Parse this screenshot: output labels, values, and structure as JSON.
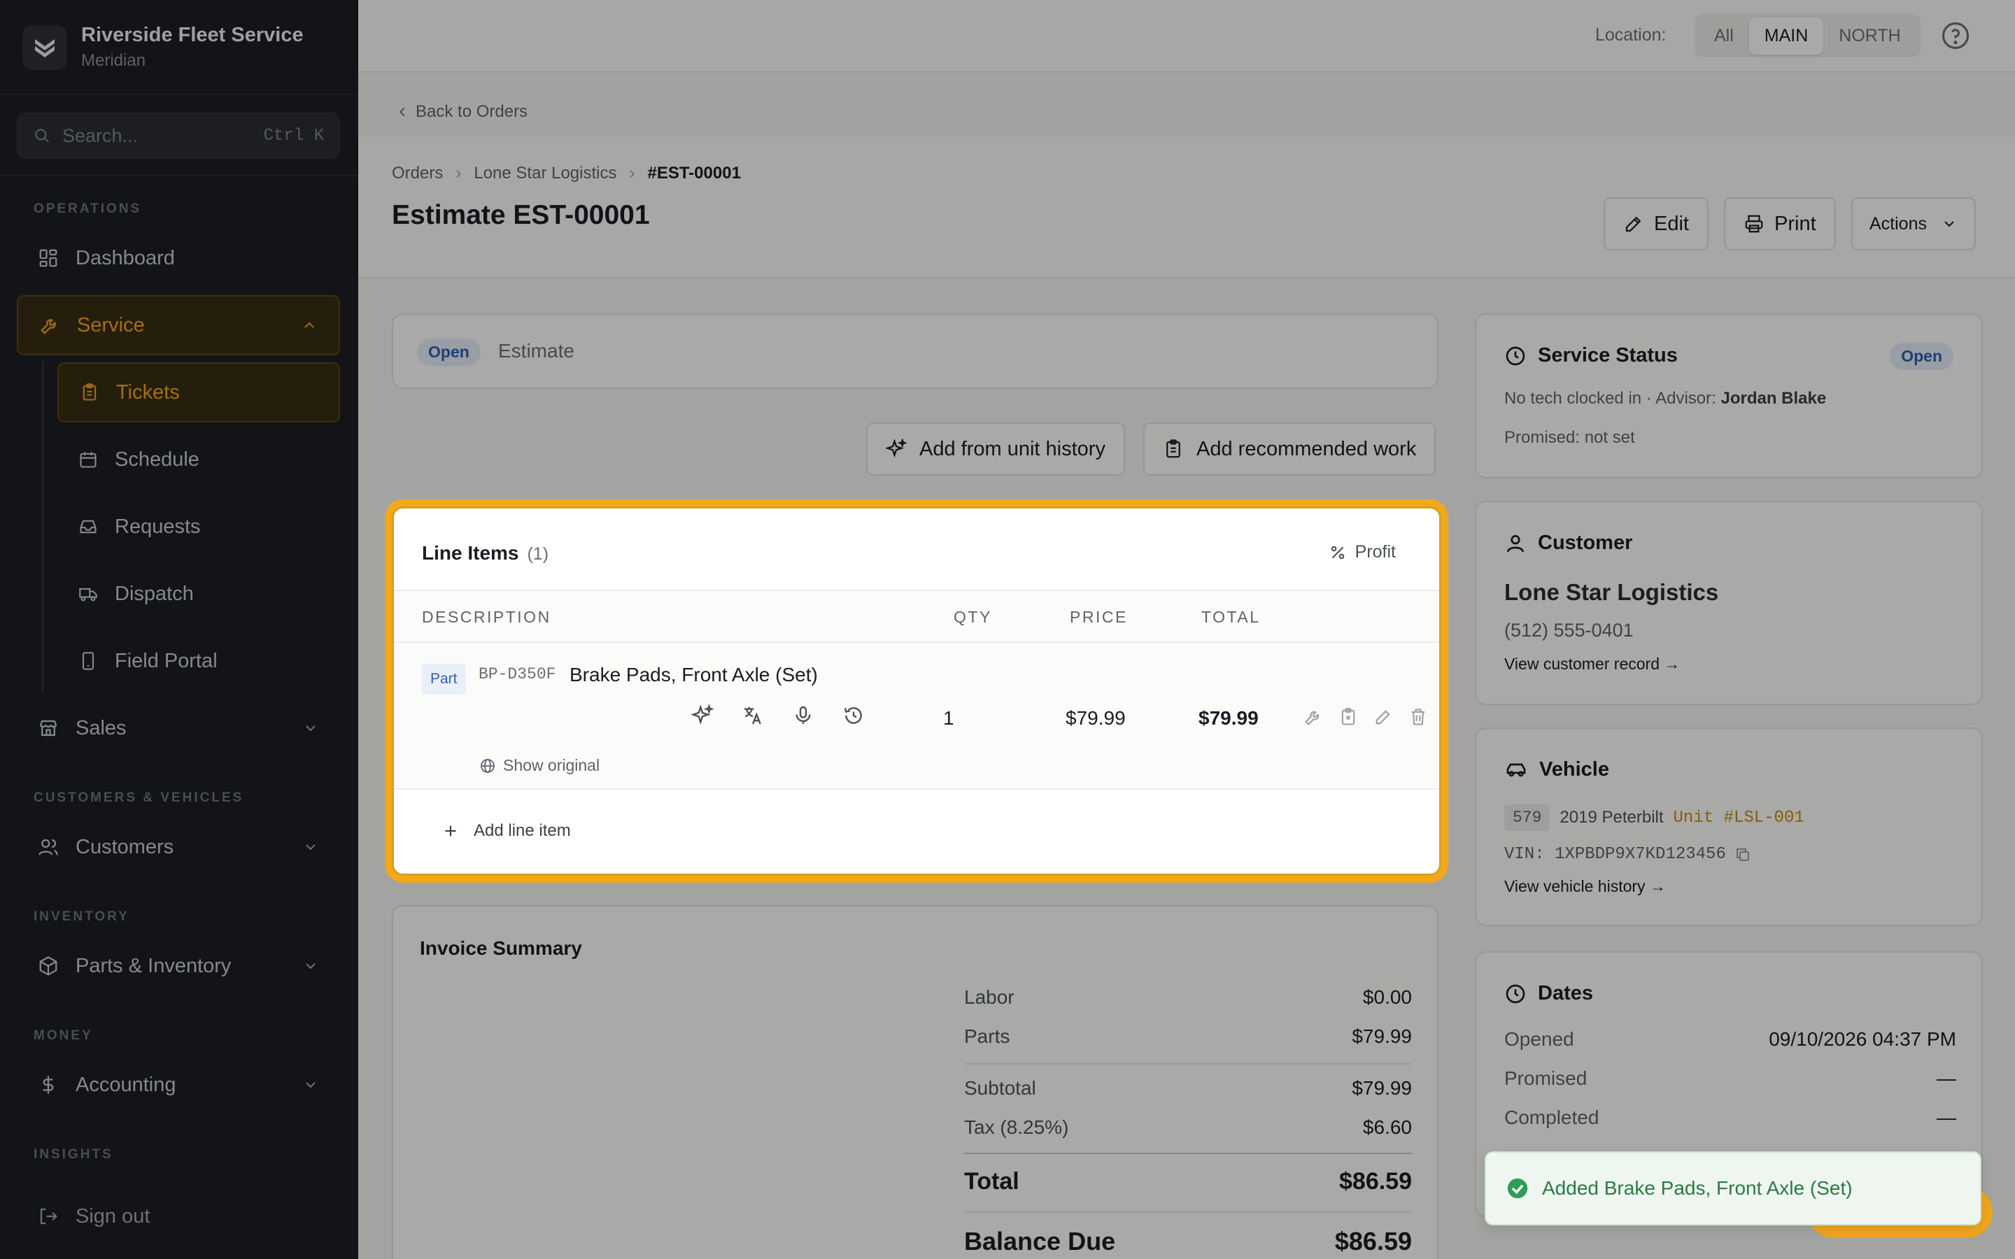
{
  "brand": {
    "name": "Riverside Fleet Service",
    "sub": "Meridian"
  },
  "search": {
    "placeholder": "Search...",
    "shortcut": "Ctrl K"
  },
  "sidebar": {
    "sections": {
      "operations": "OPERATIONS",
      "customers": "CUSTOMERS & VEHICLES",
      "inventory": "INVENTORY",
      "money": "MONEY",
      "insights": "INSIGHTS"
    },
    "items": {
      "dashboard": "Dashboard",
      "service": "Service",
      "tickets": "Tickets",
      "schedule": "Schedule",
      "requests": "Requests",
      "dispatch": "Dispatch",
      "field_portal": "Field Portal",
      "sales": "Sales",
      "customers": "Customers",
      "parts": "Parts & Inventory",
      "accounting": "Accounting",
      "signout": "Sign out"
    }
  },
  "topbar": {
    "location_label": "Location:",
    "locations": [
      "All",
      "MAIN",
      "NORTH"
    ],
    "selected": "MAIN"
  },
  "back": "Back to Orders",
  "breadcrumb": [
    "Orders",
    "Lone Star Logistics",
    "#EST-00001"
  ],
  "title": "Estimate EST-00001",
  "header_buttons": {
    "edit": "Edit",
    "print": "Print",
    "actions": "Actions"
  },
  "status_card": {
    "badge": "Open",
    "type": "Estimate"
  },
  "suggest_buttons": {
    "history": "Add from unit history",
    "recommended": "Add recommended work"
  },
  "line_items": {
    "title": "Line Items",
    "count": "(1)",
    "profit": "Profit",
    "columns": {
      "description": "DESCRIPTION",
      "qty": "QTY",
      "price": "PRICE",
      "total": "TOTAL"
    },
    "rows": [
      {
        "type": "Part",
        "sku": "BP-D350F",
        "description": "Brake Pads, Front Axle (Set)",
        "qty": "1",
        "price": "$79.99",
        "total": "$79.99",
        "show_original": "Show original"
      }
    ],
    "add_label": "Add line item"
  },
  "invoice": {
    "title": "Invoice Summary",
    "labor_label": "Labor",
    "labor": "$0.00",
    "parts_label": "Parts",
    "parts": "$79.99",
    "subtotal_label": "Subtotal",
    "subtotal": "$79.99",
    "tax_label": "Tax (8.25%)",
    "tax": "$6.60",
    "total_label": "Total",
    "total": "$86.59",
    "balance_label": "Balance Due",
    "balance": "$86.59"
  },
  "service_status": {
    "title": "Service Status",
    "badge": "Open",
    "line1_prefix": "No tech clocked in · Advisor: ",
    "advisor": "Jordan Blake",
    "promised": "Promised: not set"
  },
  "customer": {
    "title": "Customer",
    "name": "Lone Star Logistics",
    "phone": "(512) 555-0401",
    "link": "View customer record →"
  },
  "vehicle": {
    "title": "Vehicle",
    "badge": "579",
    "model": "2019 Peterbilt",
    "unit": "Unit #LSL-001",
    "vin": "VIN: 1XPBDP9X7KD123456",
    "link": "View vehicle history →"
  },
  "dates": {
    "title": "Dates",
    "opened_label": "Opened",
    "opened": "09/10/2026 04:37 PM",
    "promised_label": "Promised",
    "promised": "—",
    "completed_label": "Completed",
    "completed": "—"
  },
  "toast": "Added Brake Pads, Front Axle (Set)",
  "colors": {
    "accent": "#f0a61d",
    "sidebar_bg": "#1d1f24",
    "badge_blue": "#2f5fb0",
    "success": "#2c7a45"
  }
}
